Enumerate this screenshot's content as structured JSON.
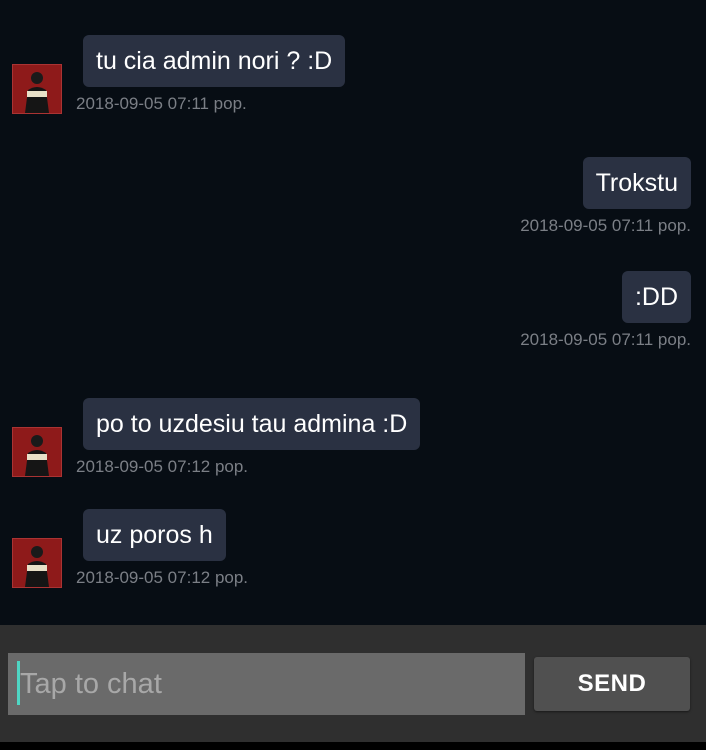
{
  "messages": [
    {
      "side": "incoming",
      "text": "tu cia admin nori ? :D",
      "time": "2018-09-05 07:11 pop."
    },
    {
      "side": "outgoing",
      "text": "Trokstu",
      "time": "2018-09-05 07:11 pop."
    },
    {
      "side": "outgoing",
      "text": ":DD",
      "time": "2018-09-05 07:11 pop."
    },
    {
      "side": "incoming",
      "text": "po to uzdesiu tau admina :D",
      "time": "2018-09-05 07:12 pop."
    },
    {
      "side": "incoming",
      "text": "uz poros h",
      "time": "2018-09-05 07:12 pop."
    }
  ],
  "composer": {
    "placeholder": "Tap to chat",
    "value": "",
    "send_label": "SEND"
  },
  "colors": {
    "background": "#070d14",
    "bubble": "#2a3142",
    "timestamp": "#7b7f86",
    "input_bar": "#2f2f2f",
    "input_field": "#6a6a6a",
    "send_button": "#505050",
    "caret": "#4fd6c4",
    "avatar": "#8e1a1a"
  },
  "icons": {
    "avatar": "user-avatar-icon"
  }
}
